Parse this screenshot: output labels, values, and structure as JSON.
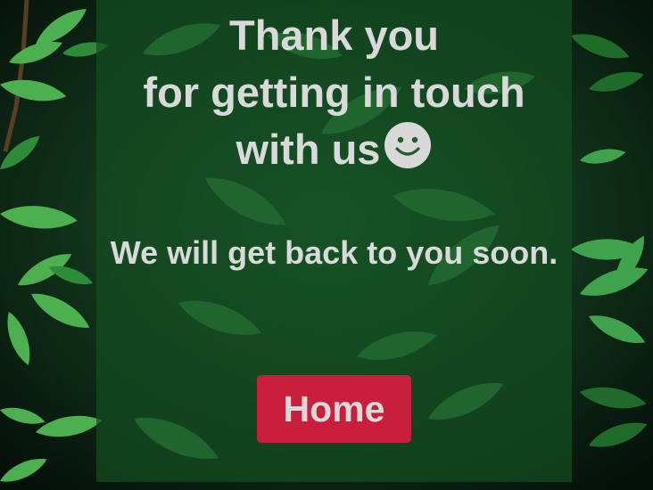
{
  "message": {
    "line1": "Thank you",
    "line2": "for getting in touch",
    "line3": "with us",
    "emoji_icon": "smiley-face-icon",
    "followup": "We will get back to you soon."
  },
  "home_button": {
    "label": "Home",
    "color": "#c8203c"
  },
  "colors": {
    "text": "#d9d9d9",
    "panel": "rgba(20,78,34,0.70)"
  }
}
